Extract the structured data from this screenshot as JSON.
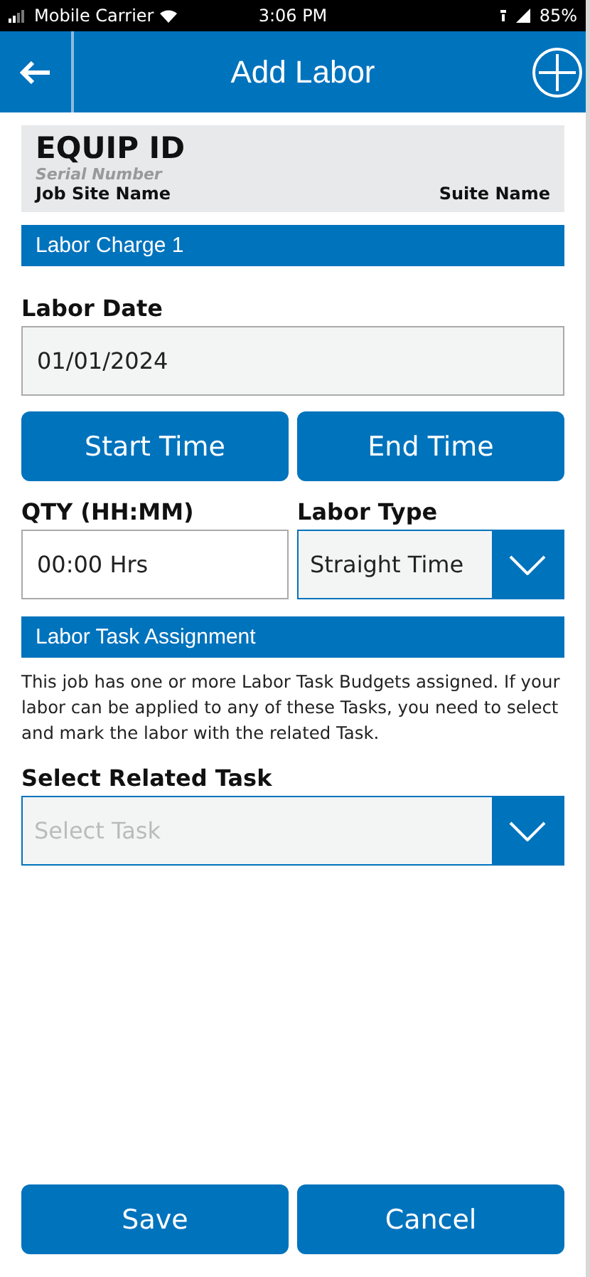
{
  "status_bar": {
    "carrier": "Mobile Carrier",
    "time": "3:06 PM",
    "battery": "85%"
  },
  "header": {
    "title": "Add Labor"
  },
  "equipment": {
    "id": "EQUIP ID",
    "serial": "Serial Number",
    "job_site": "Job Site Name",
    "suite": "Suite Name"
  },
  "labor_charge": {
    "heading": "Labor Charge 1"
  },
  "labor_date": {
    "label": "Labor Date",
    "value": "01/01/2024"
  },
  "time_buttons": [
    "Start Time",
    "End Time"
  ],
  "qty": {
    "label": "QTY (HH:MM)",
    "value": "00:00 Hrs"
  },
  "labor_type": {
    "label": "Labor Type",
    "value": "Straight Time"
  },
  "task_assignment": {
    "heading": "Labor Task Assignment",
    "description": "This job has one or more Labor Task Budgets assigned. If your labor can be applied to any of these Tasks, you need to select and mark the labor with the related Task.",
    "label": "Select Related Task",
    "placeholder": "Select Task"
  },
  "footer_buttons": [
    "Save",
    "Cancel"
  ]
}
